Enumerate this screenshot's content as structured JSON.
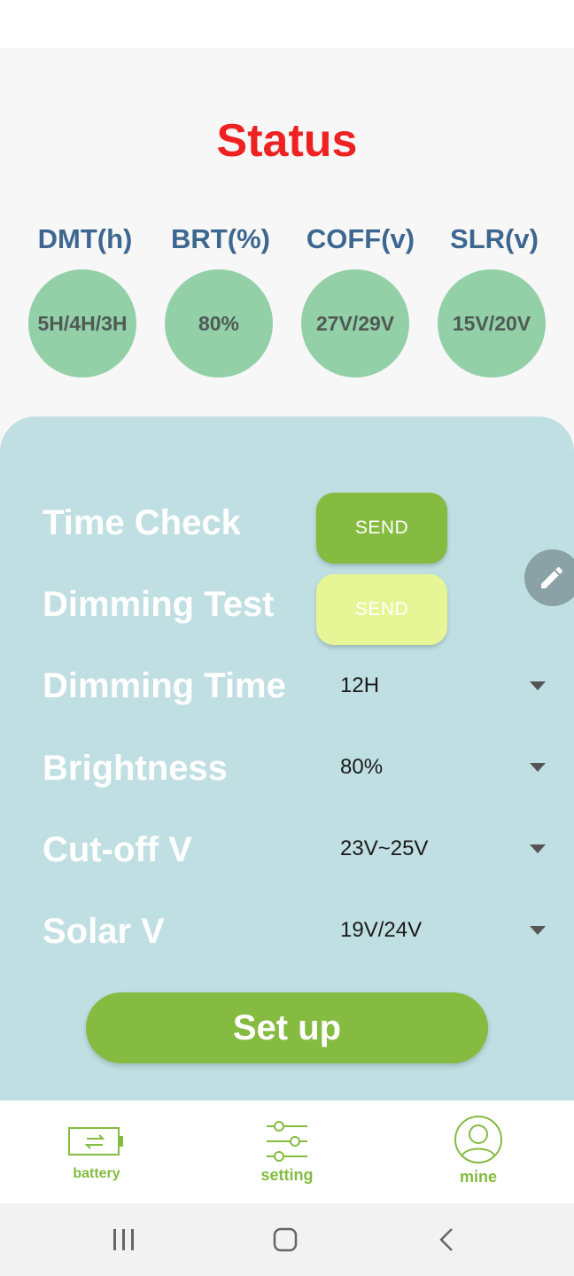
{
  "header": {
    "title": "Status"
  },
  "metrics": [
    {
      "label": "DMT(h)",
      "value": "5H/4H/3H"
    },
    {
      "label": "BRT(%)",
      "value": "80%"
    },
    {
      "label": "COFF(v)",
      "value": "27V/29V"
    },
    {
      "label": "SLR(v)",
      "value": "15V/20V"
    }
  ],
  "settings": {
    "time_check": {
      "label": "Time Check",
      "button": "SEND"
    },
    "dimming_test": {
      "label": "Dimming Test",
      "button": "SEND"
    },
    "dimming_time": {
      "label": "Dimming Time",
      "value": "12H"
    },
    "brightness": {
      "label": "Brightness",
      "value": "80%"
    },
    "cutoff": {
      "label": "Cut-off V",
      "value": "23V~25V"
    },
    "solar": {
      "label": "Solar V",
      "value": "19V/24V"
    },
    "setup_button": "Set up"
  },
  "nav": {
    "items": [
      {
        "label": "battery",
        "icon": "battery-icon"
      },
      {
        "label": "setting",
        "icon": "sliders-icon"
      },
      {
        "label": "mine",
        "icon": "user-icon"
      }
    ]
  },
  "colors": {
    "title": "#ee2222",
    "metric_label": "#3d6790",
    "circle": "#93d0a8",
    "panel": "#c0dfe2",
    "accent_green": "#84bb40",
    "send_disabled": "#e6f596"
  }
}
